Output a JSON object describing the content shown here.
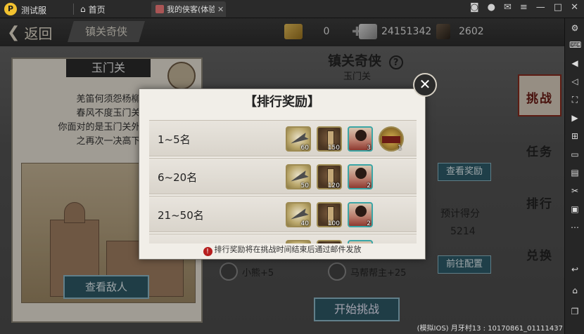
{
  "emulator": {
    "app_name": "测试服",
    "tabs": [
      {
        "label": "首页"
      },
      {
        "label": "我的侠客(体验..."
      }
    ]
  },
  "header": {
    "back_label": "返回",
    "breadcrumb": "镇关奇侠",
    "resources": [
      {
        "icon": "gold-bar-icon",
        "value": "0"
      },
      {
        "icon": "silver-ingot-icon",
        "value": "24151342"
      },
      {
        "icon": "token-icon",
        "value": "2602"
      }
    ]
  },
  "card": {
    "location": "玉门关",
    "description_lines": [
      "羌笛何须怨杨柳",
      "春风不度玉门关",
      "你面对的是玉门关外马帮",
      "之再次一决高下"
    ],
    "view_enemy_label": "查看敌人"
  },
  "event": {
    "title": "镇关奇侠",
    "help": "?",
    "subtitle": "玉门关",
    "view_rewards_label": "查看奖励",
    "predicted_label": "预计得分",
    "predicted_value": "5214",
    "configure_label": "前往配置",
    "start_label": "开始挑战",
    "members": [
      {
        "name": "小熊+5"
      },
      {
        "name": "马帮帮主+25"
      }
    ]
  },
  "side_tabs": [
    {
      "label": "挑战",
      "active": true
    },
    {
      "label": "任务",
      "active": false
    },
    {
      "label": "排行",
      "active": false
    },
    {
      "label": "兑换",
      "active": false
    }
  ],
  "modal": {
    "title": "【排行奖励】",
    "rows": [
      {
        "rank": "1~5名",
        "rewards": [
          {
            "type": "feather",
            "count": "60"
          },
          {
            "type": "scroll",
            "count": "150"
          },
          {
            "type": "hero",
            "count": "3"
          },
          {
            "type": "title",
            "count": "1"
          }
        ]
      },
      {
        "rank": "6~20名",
        "rewards": [
          {
            "type": "feather",
            "count": "50"
          },
          {
            "type": "scroll",
            "count": "120"
          },
          {
            "type": "hero",
            "count": "2"
          }
        ]
      },
      {
        "rank": "21~50名",
        "rewards": [
          {
            "type": "feather",
            "count": "40"
          },
          {
            "type": "scroll",
            "count": "100"
          },
          {
            "type": "hero",
            "count": "2"
          }
        ]
      },
      {
        "rank": "",
        "rewards": [
          {
            "type": "feather",
            "count": ""
          },
          {
            "type": "scroll",
            "count": ""
          },
          {
            "type": "hero",
            "count": ""
          }
        ]
      }
    ],
    "footer": "排行奖励将在挑战时间结束后通过邮件发放"
  },
  "watermark": "(模拟IOS) 月牙村13 : 10170861_01111437"
}
